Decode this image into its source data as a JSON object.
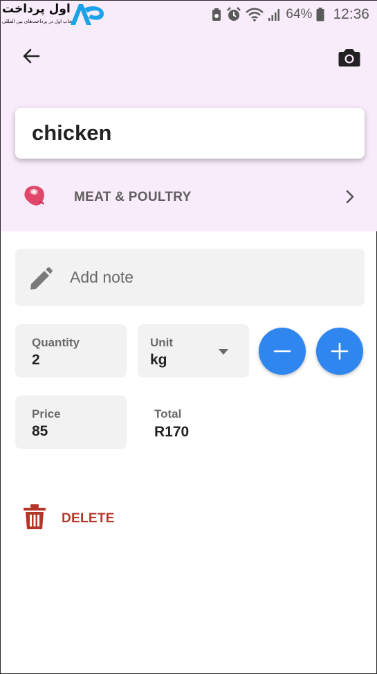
{
  "status_bar": {
    "logo_text": "اول پرداخت",
    "logo_tagline": "انتخاب اول در پرداخت‌های بین المللی",
    "battery_percent": "64%",
    "time": "12:36",
    "icons": [
      "recycle-icon",
      "alarm-icon",
      "wifi-icon",
      "signal-icon",
      "battery-icon"
    ]
  },
  "app_bar": {
    "back_icon": "arrow-left-icon",
    "camera_icon": "camera-icon"
  },
  "item": {
    "name": "chicken",
    "category": "MEAT & POULTRY",
    "category_icon": "meat-icon",
    "note_placeholder": "Add note"
  },
  "quantity": {
    "label": "Quantity",
    "value": "2"
  },
  "unit": {
    "label": "Unit",
    "value": "kg"
  },
  "price": {
    "label": "Price",
    "value": "85"
  },
  "total": {
    "label": "Total",
    "value": "R170"
  },
  "actions": {
    "delete_label": "DELETE"
  },
  "colors": {
    "header_bg": "#f8ebfa",
    "accent_blue": "#2f86ee",
    "delete_red": "#b5352a",
    "meat_pink": "#e0476a",
    "field_bg": "#f2f2f2"
  }
}
